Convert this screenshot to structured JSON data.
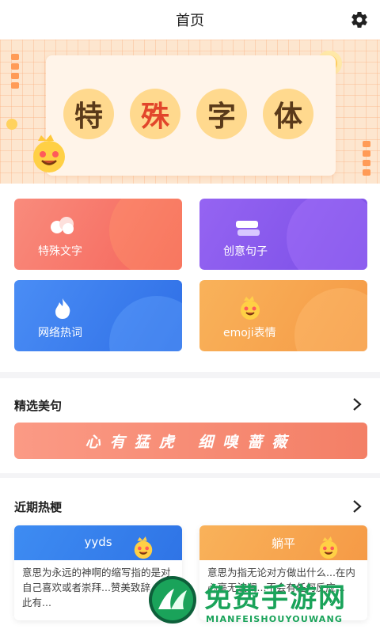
{
  "header": {
    "title": "首页",
    "settings_icon": "gear-icon"
  },
  "banner": {
    "chars": [
      "特",
      "殊",
      "字",
      "体"
    ]
  },
  "categories": [
    {
      "label": "特殊文字",
      "icon": "cloud-icon",
      "color": "#f97c6e"
    },
    {
      "label": "创意句子",
      "icon": "message-icon",
      "color": "#8c5cf0"
    },
    {
      "label": "网络热词",
      "icon": "flame-icon",
      "color": "#3b7ef0"
    },
    {
      "label": "emoji表情",
      "icon": "emoji-face-icon",
      "color": "#f7a24e"
    }
  ],
  "featured": {
    "title": "精选美句",
    "quote": "心有猛虎 细嗅蔷薇"
  },
  "trending": {
    "title": "近期热梗",
    "items": [
      {
        "term": "yyds",
        "desc": "意思为永远的神啊的缩写指的是对自己喜欢或者崇拜...赞美致辞，对此有...",
        "color": "#3b86f0"
      },
      {
        "term": "躺平",
        "desc": "意思为指无论对方做出什么...在内心毫无波澜...不会有任何反应...",
        "color": "#f8a24e"
      }
    ]
  },
  "watermark": {
    "brand": "免费手游网",
    "brand_en": "MIANFEISHOUYOUWANG"
  }
}
